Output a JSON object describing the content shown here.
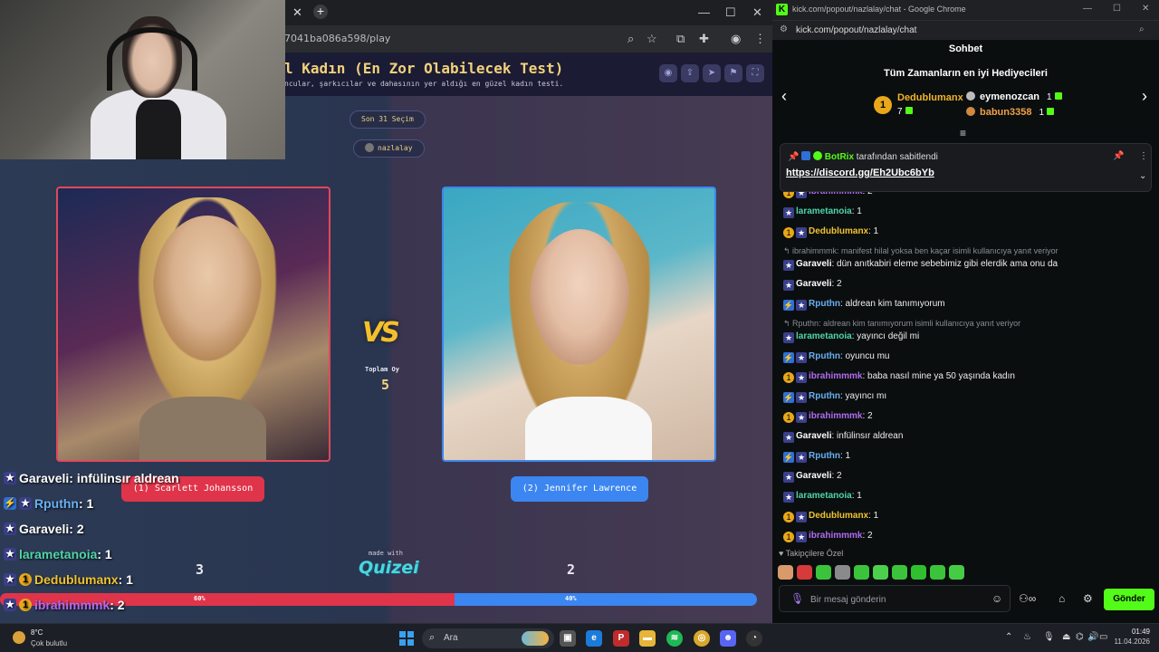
{
  "left_browser": {
    "url": "7041ba086a598/play",
    "tab_close": "✕",
    "new_tab": "+",
    "window_controls": [
      "—",
      "☐",
      "✕"
    ]
  },
  "quiz": {
    "title": "l Kadın (En Zor Olabilecek Test)",
    "subtitle": "ncular, şarkıcılar ve dahasının yer aldığı en güzel kadın testi.",
    "round_label": "Son 31 Seçim",
    "streamer": "nazlalay",
    "vs_text": "VS",
    "total_votes_label": "Toplam Oy",
    "total_votes": "5",
    "option_left": {
      "label": "(1) Scarlett Johansson",
      "score": "3",
      "percent": 60
    },
    "option_right": {
      "label": "(2) Jennifer Lawrence",
      "score": "2",
      "percent": 40
    },
    "percent_left_label": "60%",
    "percent_right_label": "40%",
    "made_with": "made with",
    "logo": "Quizei",
    "colors": {
      "left": "#e0344a",
      "right": "#3b86f0",
      "title": "#f2d27a"
    }
  },
  "overlay_chat": [
    {
      "user": "Garaveli",
      "text": " : infülinsır aldrean",
      "color": "#ffffff",
      "badges": [
        "star"
      ]
    },
    {
      "user": "Rputhn",
      "text": " : 1",
      "color": "#6ab0f3",
      "badges": [
        "prime",
        "star"
      ]
    },
    {
      "user": "Garaveli",
      "text": " : 2",
      "color": "#ffffff",
      "badges": [
        "star"
      ]
    },
    {
      "user": "larametanoia",
      "text": " : 1",
      "color": "#4fd6a8",
      "badges": [
        "star"
      ]
    },
    {
      "user": "Dedublumanx",
      "text": " : 1",
      "color": "#f0c330",
      "badges": [
        "star",
        "coin"
      ]
    },
    {
      "user": "ibrahimmmk",
      "text": " : 2",
      "color": "#b06cf0",
      "badges": [
        "star",
        "coin"
      ]
    }
  ],
  "right_browser": {
    "title": "kick.com/popout/nazlalay/chat - Google Chrome",
    "url": "kick.com/popout/nazlalay/chat"
  },
  "chat": {
    "header": "Sohbet",
    "gifters_title": "Tüm Zamanların en iyi Hediyecileri",
    "top_gifter": {
      "rank": "1",
      "name": "Dedublumanx",
      "value": "7"
    },
    "gifters": [
      {
        "name": "eymenozcan",
        "value": "1",
        "color": "#ffffff",
        "dot": "#bbbbbb"
      },
      {
        "name": "babun3358",
        "value": "1",
        "color": "#f0a04a",
        "dot": "#d08a40"
      }
    ],
    "pinned": {
      "bot": "BotRix",
      "suffix": " tarafından sabitlendi",
      "link": "https://discord.gg/Eh2Ubc6bYb"
    },
    "messages": [
      {
        "type": "msg",
        "user": "ibrahimmmk",
        "text": ": 2",
        "color": "#b06cf0",
        "badges": [
          "coin",
          "star"
        ]
      },
      {
        "type": "msg",
        "user": "larametanoia",
        "text": ": 1",
        "color": "#4fd6a8",
        "badges": [
          "star"
        ]
      },
      {
        "type": "msg",
        "user": "Dedublumanx",
        "text": ": 1",
        "color": "#f0c330",
        "badges": [
          "coin",
          "star"
        ]
      },
      {
        "type": "reply",
        "text": "↰ ibrahimmmk: manifest hilal yoksa ben kaçar isimli kullanıcıya yanıt veriyor"
      },
      {
        "type": "msg",
        "user": "Garaveli",
        "text": ": dün anıtkabiri eleme sebebimiz gibi elerdik ama onu da",
        "color": "#ffffff",
        "badges": [
          "star"
        ]
      },
      {
        "type": "msg",
        "user": "Garaveli",
        "text": ": 2",
        "color": "#ffffff",
        "badges": [
          "star"
        ]
      },
      {
        "type": "msg",
        "user": "Rputhn",
        "text": ": aldrean kim tanımıyorum",
        "color": "#6ab0f3",
        "badges": [
          "prime",
          "star"
        ]
      },
      {
        "type": "reply",
        "text": "↰ Rputhn: aldrean kim tanımıyorum isimli kullanıcıya yanıt veriyor"
      },
      {
        "type": "msg",
        "user": "larametanoia",
        "text": ": yayıncı değil mi",
        "color": "#4fd6a8",
        "badges": [
          "star"
        ]
      },
      {
        "type": "msg",
        "user": "Rputhn",
        "text": ": oyuncu mu",
        "color": "#6ab0f3",
        "badges": [
          "prime",
          "star"
        ]
      },
      {
        "type": "msg",
        "user": "ibrahimmmk",
        "text": ": baba nasıl mine ya 50 yaşında kadın",
        "color": "#b06cf0",
        "badges": [
          "coin",
          "star"
        ]
      },
      {
        "type": "msg",
        "user": "Rputhn",
        "text": ": yayıncı mı",
        "color": "#6ab0f3",
        "badges": [
          "prime",
          "star"
        ]
      },
      {
        "type": "msg",
        "user": "ibrahimmmk",
        "text": ": 2",
        "color": "#b06cf0",
        "badges": [
          "coin",
          "star"
        ]
      },
      {
        "type": "msg",
        "user": "Garaveli",
        "text": ": infülinsır aldrean",
        "color": "#ffffff",
        "badges": [
          "star"
        ]
      },
      {
        "type": "msg",
        "user": "Rputhn",
        "text": ": 1",
        "color": "#6ab0f3",
        "badges": [
          "prime",
          "star"
        ]
      },
      {
        "type": "msg",
        "user": "Garaveli",
        "text": ": 2",
        "color": "#ffffff",
        "badges": [
          "star"
        ]
      },
      {
        "type": "msg",
        "user": "larametanoia",
        "text": ": 1",
        "color": "#4fd6a8",
        "badges": [
          "star"
        ]
      },
      {
        "type": "msg",
        "user": "Dedublumanx",
        "text": ": 1",
        "color": "#f0c330",
        "badges": [
          "coin",
          "star"
        ]
      },
      {
        "type": "msg",
        "user": "ibrahimmmk",
        "text": ": 2",
        "color": "#b06cf0",
        "badges": [
          "coin",
          "star"
        ]
      }
    ],
    "followers_only": "♥ Takipçilere Özel",
    "input_placeholder": "Bir mesaj gönderin",
    "send_label": "Gönder",
    "accent": "#53fc18"
  },
  "taskbar": {
    "temp": "8°C",
    "weather": "Çok bulutlu",
    "search_label": "Ara",
    "time": "01:49",
    "date": "11.04.2026"
  }
}
